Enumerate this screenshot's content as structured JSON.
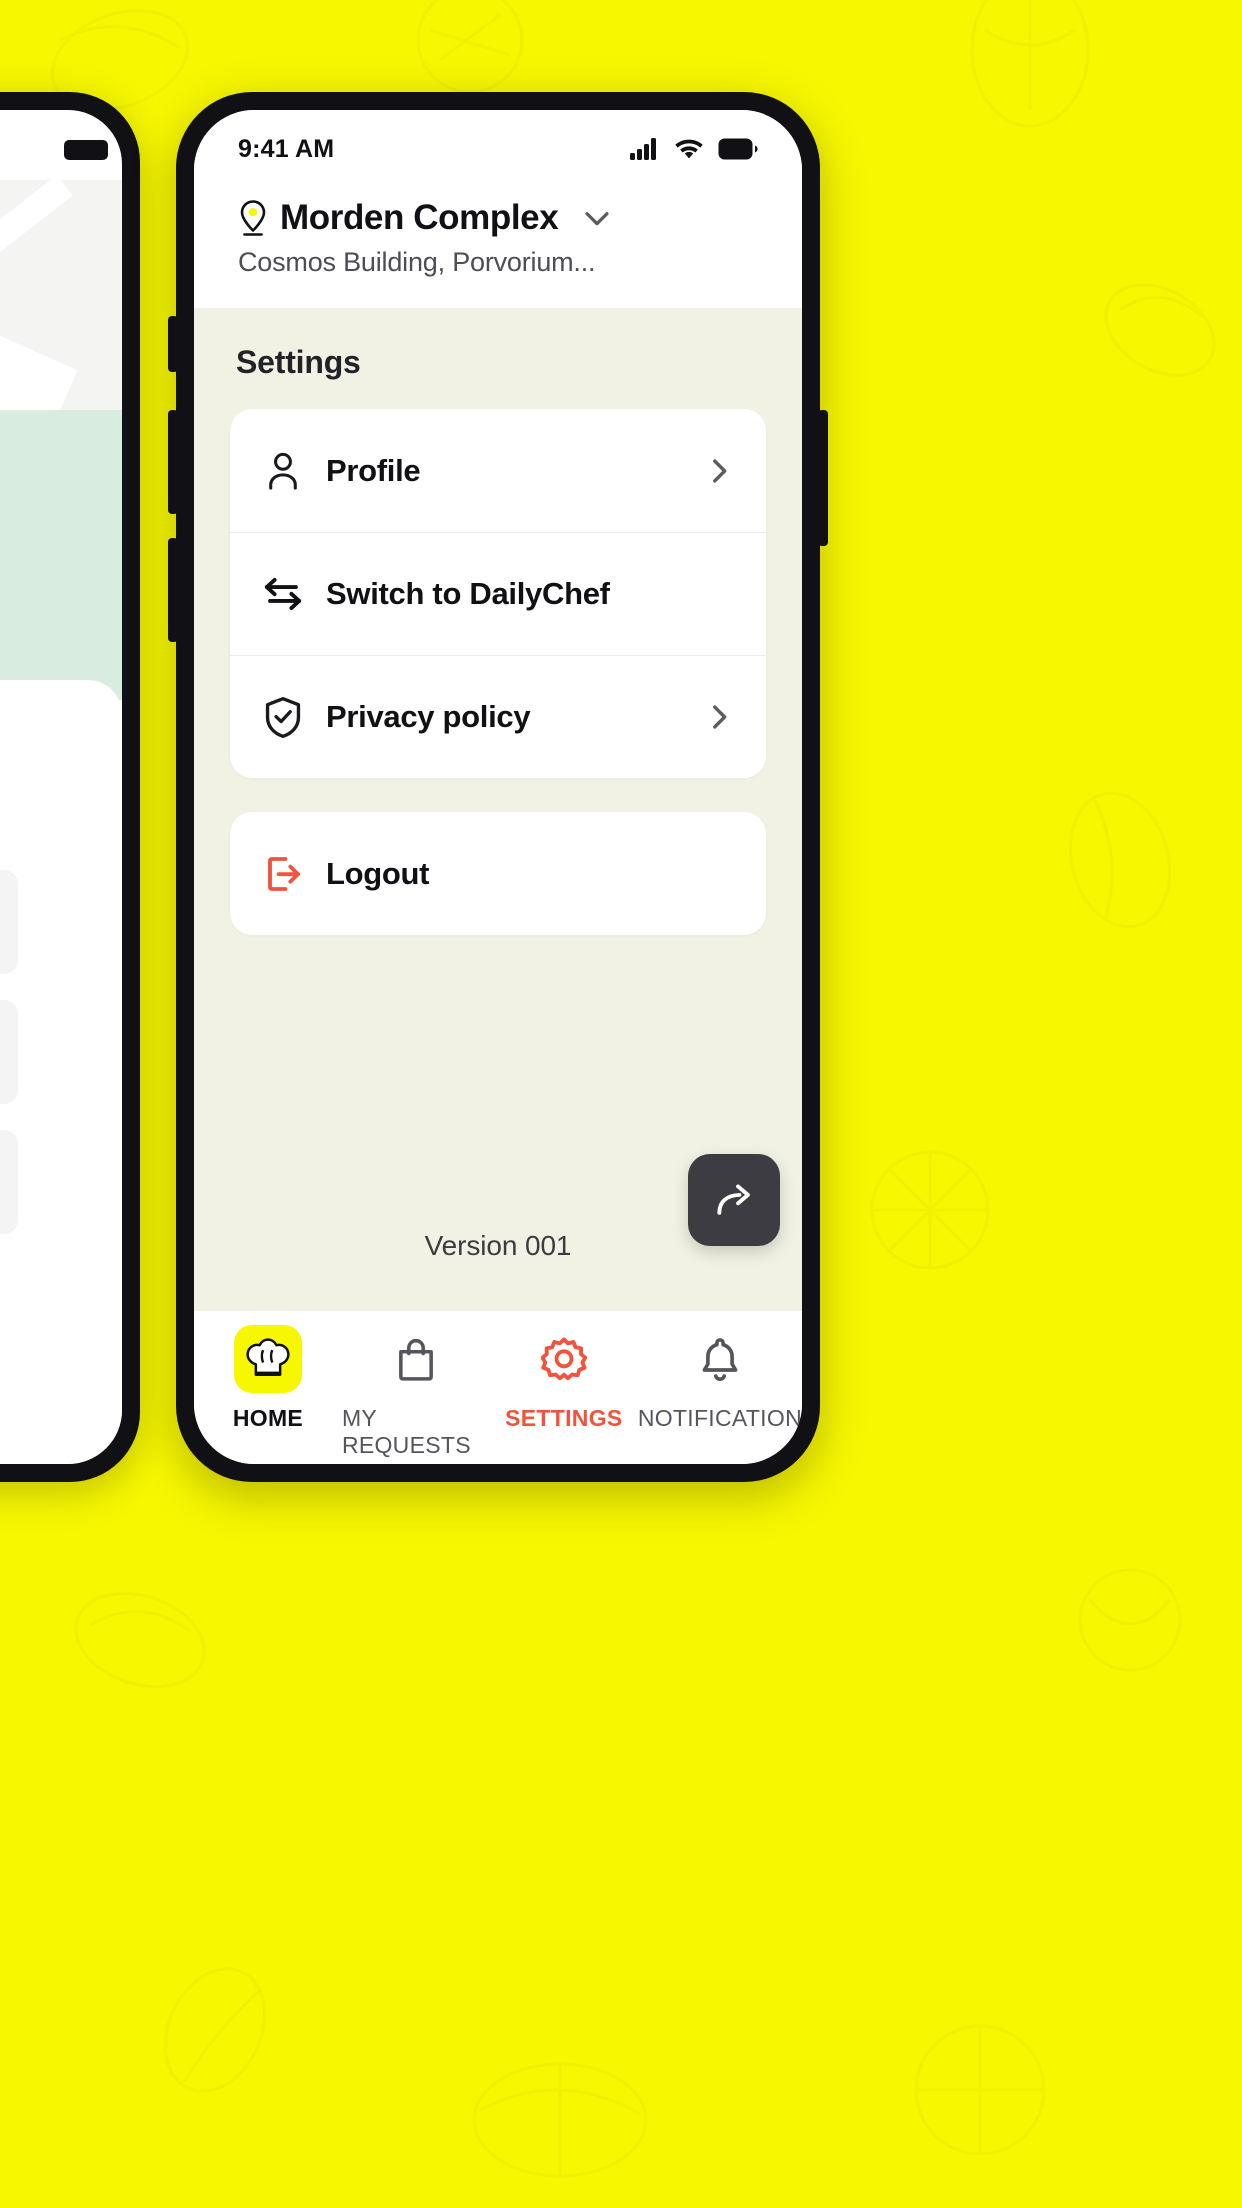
{
  "theme": {
    "background_yellow": "#f7f700",
    "content_cream": "#f2f2e4",
    "accent_orange": "#f0543c",
    "bezel_black": "#111014",
    "card_white": "#ffffff"
  },
  "status_bar": {
    "time": "9:41 AM",
    "icons": [
      "cellular-signal-icon",
      "wifi-icon",
      "battery-icon"
    ]
  },
  "header": {
    "pin_icon": "location-pin-icon",
    "location_name": "Morden Complex",
    "chevron": "chevron-down-icon",
    "address": "Cosmos Building, Porvorium..."
  },
  "main": {
    "section_title": "Settings",
    "menu_groups": [
      {
        "items": [
          {
            "icon": "user-icon",
            "label": "Profile",
            "has_chevron": true
          },
          {
            "icon": "swap-icon",
            "label": "Switch to DailyChef",
            "has_chevron": false
          },
          {
            "icon": "shield-check-icon",
            "label": "Privacy policy",
            "has_chevron": true
          }
        ]
      },
      {
        "items": [
          {
            "icon": "logout-icon",
            "label": "Logout",
            "has_chevron": false
          }
        ]
      }
    ],
    "version_text": "Version 001",
    "fab": {
      "icon": "share-arrow-icon",
      "label": ""
    }
  },
  "bottom_nav": {
    "items": [
      {
        "icon": "chef-hat-icon",
        "label": "HOME",
        "active": true
      },
      {
        "icon": "shopping-bag-icon",
        "label": "MY REQUESTS",
        "active": false
      },
      {
        "icon": "gear-icon",
        "label": "SETTINGS",
        "active": false,
        "accent": true
      },
      {
        "icon": "bell-icon",
        "label": "NOTIFICATION",
        "active": false
      }
    ]
  }
}
